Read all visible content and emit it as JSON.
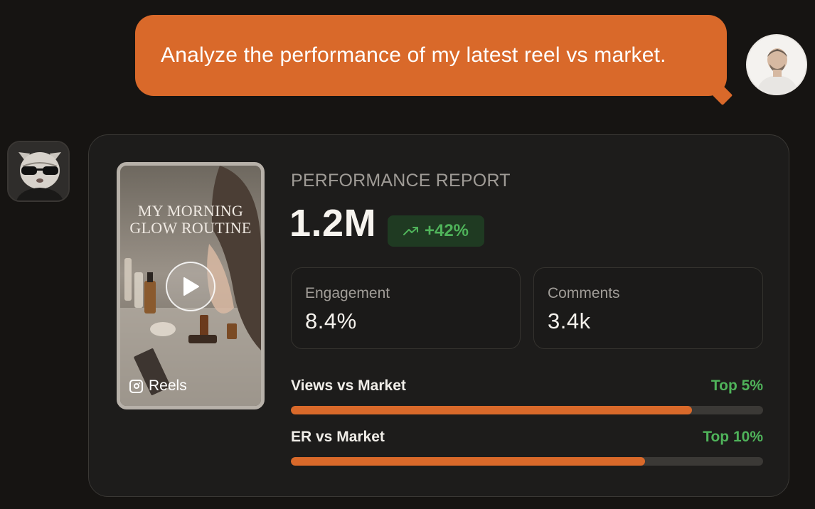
{
  "user_message": {
    "text": "Analyze the performance of my latest reel vs market."
  },
  "icons": {
    "user_avatar": "user-avatar-photo",
    "bot_avatar": "cat-with-sunglasses-avatar",
    "play": "play-icon",
    "instagram": "instagram-icon",
    "trend": "trending-up-icon"
  },
  "report": {
    "thumbnail": {
      "title_line1": "MY MORNING",
      "title_line2": "GLOW ROUTINE",
      "platform_label": "Reels"
    },
    "title": "PERFORMANCE REPORT",
    "views": "1.2M",
    "change": "+42%",
    "stats": [
      {
        "label": "Engagement",
        "value": "8.4%"
      },
      {
        "label": "Comments",
        "value": "3.4k"
      }
    ],
    "comparisons": [
      {
        "label": "Views vs Market",
        "rank": "Top 5%",
        "fill": 0.85
      },
      {
        "label": "ER vs Market",
        "rank": "Top 10%",
        "fill": 0.75
      }
    ]
  },
  "colors": {
    "accent": "#d9692a",
    "positive": "#4fb35a",
    "background": "#161412",
    "card": "#1d1c1b"
  }
}
